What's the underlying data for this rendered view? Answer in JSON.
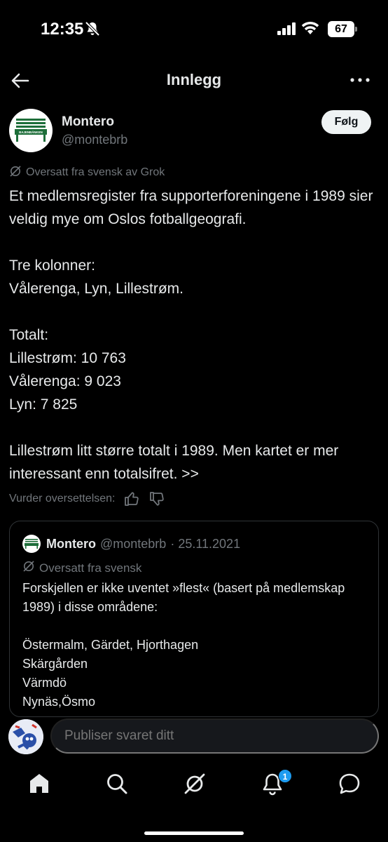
{
  "status_bar": {
    "time": "12:35",
    "battery": "67"
  },
  "nav": {
    "title": "Innlegg"
  },
  "author": {
    "name": "Montero",
    "handle": "@montebrb",
    "avatar_label": "BAJENBÄNKEN"
  },
  "follow_label": "Følg",
  "translated_note": "Oversatt fra svensk av Grok",
  "post": {
    "paragraphs": [
      "Et medlemsregister fra supporterforeningene i 1989 sier veldig mye om Oslos fotballgeografi.",
      "Tre kolonner:\nVålerenga, Lyn, Lillestrøm.",
      "Totalt:\nLillestrøm: 10 763\nVålerenga: 9 023\nLyn: 7 825",
      "Lillestrøm litt større totalt i 1989. Men kartet er mer interessant enn totalsifret. >>"
    ]
  },
  "rate_label": "Vurder oversettelsen:",
  "quote": {
    "name": "Montero",
    "handle": "@montebrb",
    "date": "· 25.11.2021",
    "translated_note": "Oversatt fra svensk",
    "body": "Forskjellen er ikke uventet »flest« (basert på medlemskap 1989) i disse områdene:\n\nÖstermalm, Gärdet, Hjorthagen\nSkärgården\nVärmdö\nNynäs,Ösmo"
  },
  "reply": {
    "placeholder": "Publiser svaret ditt"
  },
  "tabs": {
    "notifications_badge": "1"
  },
  "icons": [
    "back-arrow-icon",
    "more-icon",
    "translate-icon",
    "thumbs-up-icon",
    "thumbs-down-icon",
    "home-icon",
    "search-icon",
    "grok-icon",
    "bell-icon",
    "messages-icon",
    "bell-muted-icon",
    "signal-icon",
    "wifi-icon",
    "battery-icon"
  ],
  "colors": {
    "background": "#000000",
    "text": "#e7e9ea",
    "secondary": "#71767b",
    "accent": "#1d9bf0",
    "border": "#2f3336"
  }
}
